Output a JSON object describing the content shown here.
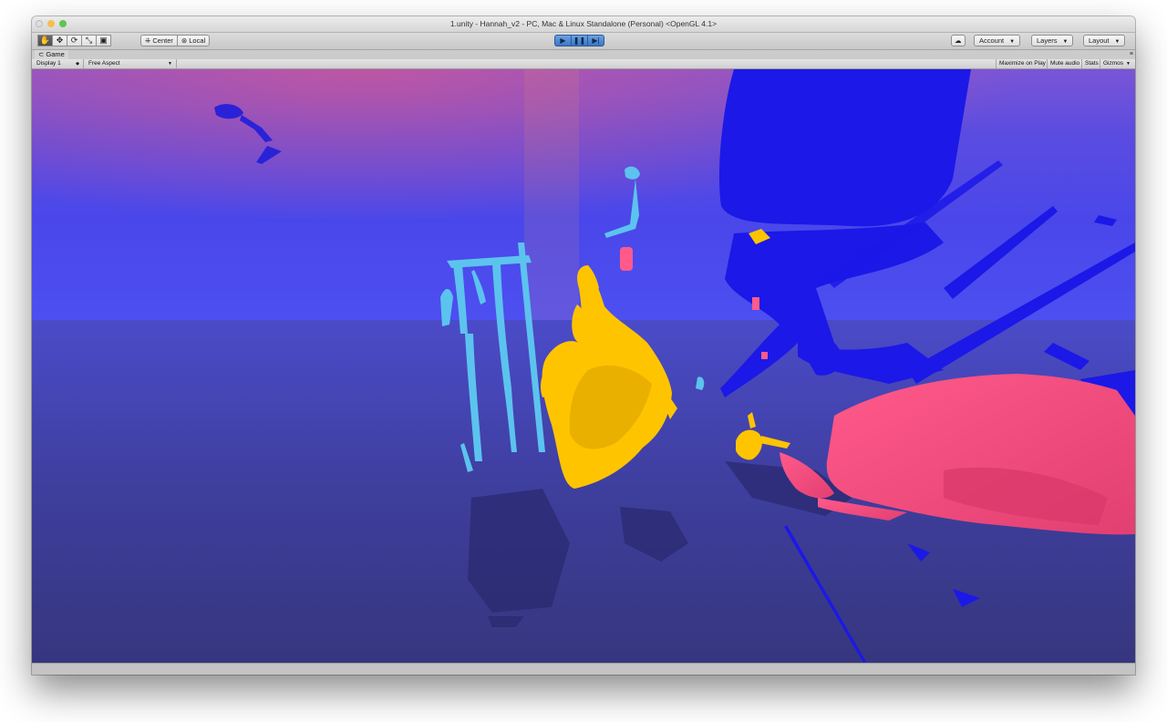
{
  "window": {
    "title": "1.unity - Hannah_v2 - PC, Mac & Linux Standalone (Personal) <OpenGL 4.1>"
  },
  "toolbar": {
    "transform_tools": [
      {
        "name": "hand-tool",
        "glyph": "✋"
      },
      {
        "name": "move-tool",
        "glyph": "✥"
      },
      {
        "name": "rotate-tool",
        "glyph": "⟳"
      },
      {
        "name": "scale-tool",
        "glyph": "⤡"
      },
      {
        "name": "rect-tool",
        "glyph": "▣"
      }
    ],
    "pivot_label": "Center",
    "space_label": "Local",
    "play_glyph": "▶",
    "pause_glyph": "❚❚",
    "step_glyph": "▶|",
    "cloud_glyph": "☁",
    "account_label": "Account",
    "layers_label": "Layers",
    "layout_label": "Layout"
  },
  "game_view": {
    "tab_label": "Game",
    "display_label": "Display 1",
    "aspect_label": "Free Aspect",
    "maximize_label": "Maximize on Play",
    "mute_label": "Mute audio",
    "stats_label": "Stats",
    "gizmos_label": "Gizmos"
  },
  "colors": {
    "play_active": "#3b77c6",
    "scan_yellow": "#ffc400",
    "scan_cyan": "#55bfe8",
    "scan_pink": "#f24a7c",
    "scan_blue": "#1a14f0"
  }
}
